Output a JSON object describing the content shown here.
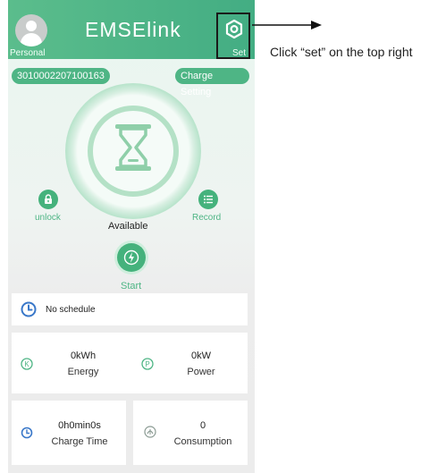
{
  "header": {
    "title": "EMSElink",
    "personal_label": "Personal",
    "set_label": "Set"
  },
  "annotation": {
    "text": "Click “set” on the top right"
  },
  "device": {
    "serial": "3010002207100163",
    "charge_setting_label": "Charge Setting"
  },
  "controls": {
    "unlock_label": "unlock",
    "record_label": "Record",
    "status": "Available",
    "start_label": "Start"
  },
  "schedule": {
    "text": "No schedule"
  },
  "stats": {
    "energy_value": "0kWh",
    "energy_label": "Energy",
    "power_value": "0kW",
    "power_label": "Power",
    "charge_time_value": "0h0min0s",
    "charge_time_label": "Charge Time",
    "consumption_value": "0",
    "consumption_label": "Consumption"
  },
  "colors": {
    "accent": "#4eb585",
    "header": "#4fb487",
    "schedule_icon": "#3a78c9"
  },
  "icons": [
    "avatar-icon",
    "gear-icon",
    "arrow-right-icon",
    "hourglass-icon",
    "lock-icon",
    "list-icon",
    "lightning-icon",
    "clock-icon",
    "energy-k-icon",
    "power-p-icon",
    "timer-icon",
    "consumption-icon"
  ]
}
